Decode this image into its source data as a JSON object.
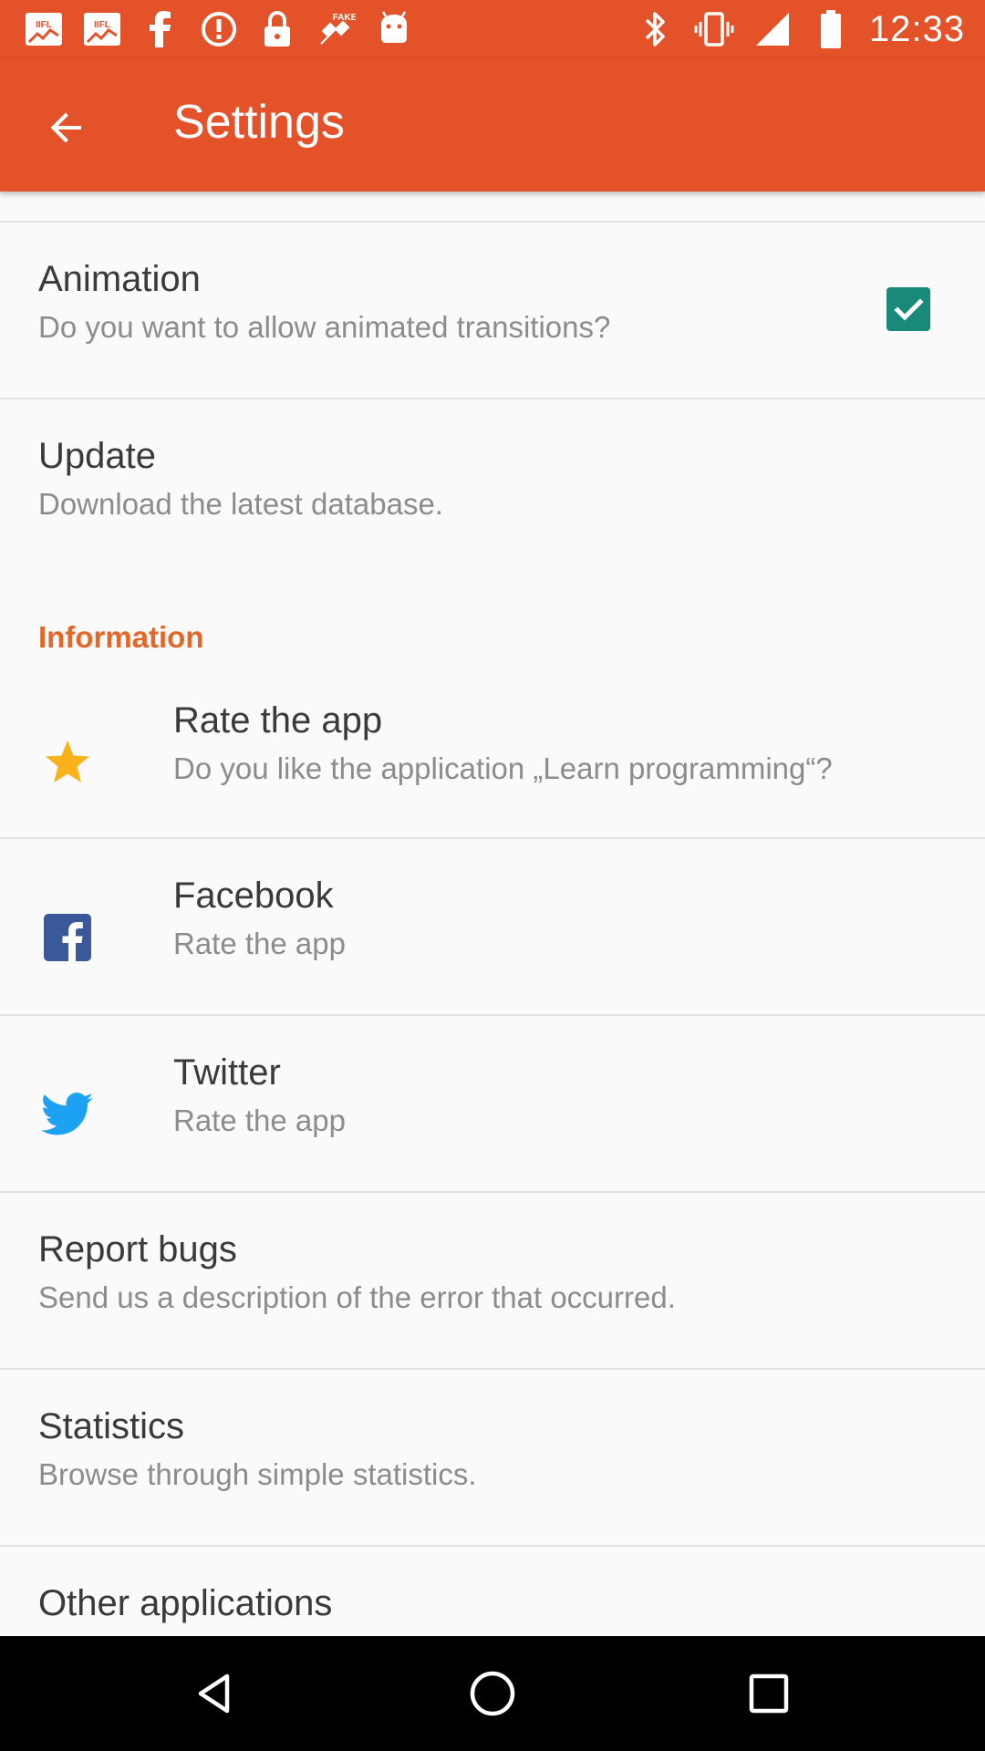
{
  "status_bar": {
    "time": "12:33",
    "left_icons": [
      "iifl-markets-icon",
      "iifl-markets-icon",
      "facebook-icon",
      "alert-icon",
      "lock-icon",
      "fake-gps-icon",
      "android-icon"
    ],
    "right_icons": [
      "bluetooth-icon",
      "vibrate-icon",
      "signal-icon",
      "battery-icon"
    ]
  },
  "app_bar": {
    "title": "Settings",
    "background": "#e4522a"
  },
  "preferences": {
    "animation": {
      "title": "Animation",
      "summary": "Do you want to allow animated transitions?",
      "checked": true
    },
    "update": {
      "title": "Update",
      "summary": "Download the latest database."
    },
    "information_category": "Information",
    "rate": {
      "title": "Rate the app",
      "summary": "Do you like the application „Learn programming“?"
    },
    "facebook": {
      "title": "Facebook",
      "summary": "Rate the app"
    },
    "twitter": {
      "title": "Twitter",
      "summary": "Rate the app"
    },
    "report_bugs": {
      "title": "Report bugs",
      "summary": "Send us a description of the error that occurred."
    },
    "statistics": {
      "title": "Statistics",
      "summary": "Browse through simple statistics."
    },
    "other_apps": {
      "title": "Other applications"
    }
  },
  "colors": {
    "accent": "#e4522a",
    "category": "#e4672a",
    "checkbox": "#19897a",
    "star": "#f9b21a",
    "facebook": "#3b5998",
    "twitter": "#1da1f2"
  },
  "nav_bar": {
    "buttons": [
      "back-triangle-icon",
      "home-circle-icon",
      "recents-square-icon"
    ]
  }
}
